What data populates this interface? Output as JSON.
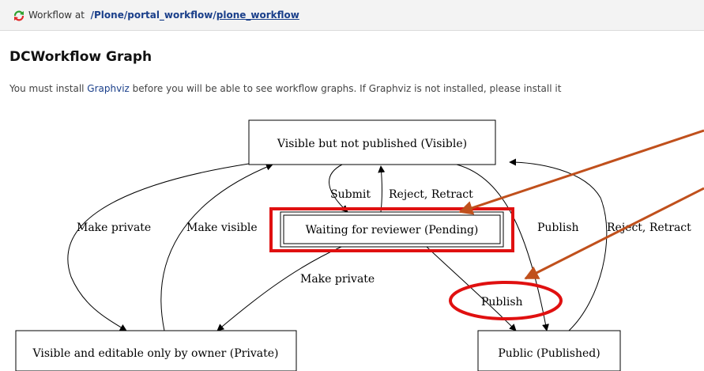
{
  "header": {
    "prefix": "Workflow at",
    "path_root": "/Plone/",
    "path_mid": "portal_workflow",
    "path_sep": "/",
    "path_link": "plone_workflow"
  },
  "page": {
    "title": "DCWorkflow Graph",
    "notice_pre": "You must install ",
    "notice_link": "Graphviz",
    "notice_post": " before you will be able to see workflow graphs. If Graphviz is not installed, please install it"
  },
  "graph": {
    "states": {
      "visible": "Visible but not published (Visible)",
      "pending": "Waiting for reviewer (Pending)",
      "private": "Visible and editable only by owner (Private)",
      "published": "Public (Published)"
    },
    "transitions": {
      "submit": "Submit",
      "reject_retract_1": "Reject, Retract",
      "make_private_1": "Make private",
      "make_visible": "Make visible",
      "publish_1": "Publish",
      "reject_retract_2": "Reject, Retract",
      "make_private_2": "Make private",
      "publish_2": "Publish"
    }
  },
  "colors": {
    "highlight": "#e01010",
    "arrow": "#c0501c",
    "link": "#1a3f8a"
  }
}
